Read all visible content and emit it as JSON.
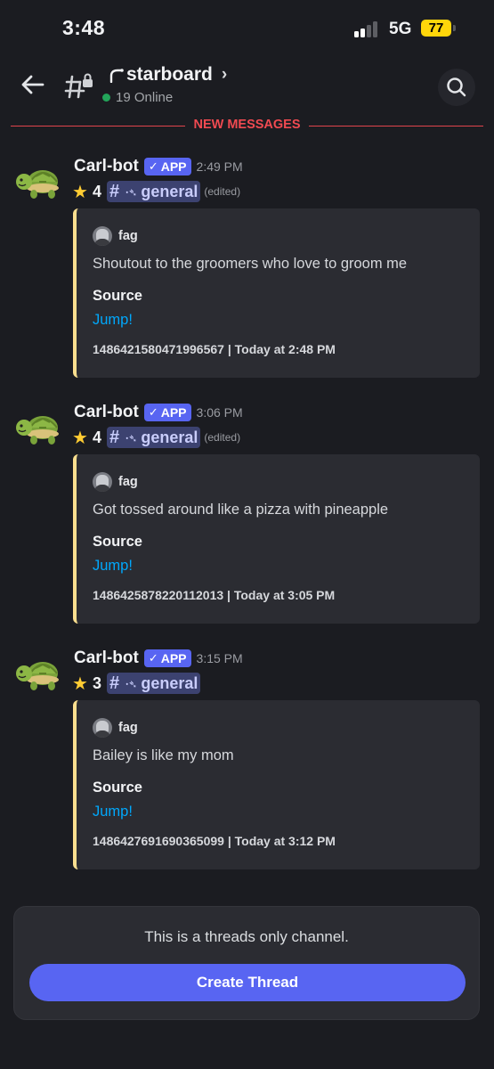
{
  "status_bar": {
    "time": "3:48",
    "network": "5G",
    "battery": "77"
  },
  "header": {
    "channel_name": "starboard",
    "online_text": "19 Online"
  },
  "divider": {
    "label": "NEW MESSAGES"
  },
  "messages": [
    {
      "author": "Carl-bot",
      "badge": "APP",
      "timestamp": "2:49 PM",
      "star_count": "4",
      "channel_mention": "general",
      "edited": "(edited)",
      "embed": {
        "author": "fag",
        "description": "Shoutout to the groomers who love to groom me",
        "field_name": "Source",
        "field_value": "Jump!",
        "footer": "1486421580471996567 | Today at 2:48 PM"
      }
    },
    {
      "author": "Carl-bot",
      "badge": "APP",
      "timestamp": "3:06 PM",
      "star_count": "4",
      "channel_mention": "general",
      "edited": "(edited)",
      "embed": {
        "author": "fag",
        "description": "Got tossed around like a pizza with pineapple",
        "field_name": "Source",
        "field_value": "Jump!",
        "footer": "1486425878220112013 | Today at 3:05 PM"
      }
    },
    {
      "author": "Carl-bot",
      "badge": "APP",
      "timestamp": "3:15 PM",
      "star_count": "3",
      "channel_mention": "general",
      "edited": "",
      "embed": {
        "author": "fag",
        "description": "Bailey is like my mom",
        "field_name": "Source",
        "field_value": "Jump!",
        "footer": "1486427691690365099 | Today at 3:12 PM"
      }
    }
  ],
  "threads_panel": {
    "notice": "This is a threads only channel.",
    "button_label": "Create Thread"
  },
  "colors": {
    "background": "#1b1c21",
    "accent": "#5865f2",
    "embed_border": "#fcdf8f",
    "new_messages": "#f04a51",
    "link": "#00a8fc",
    "online": "#23a55a"
  },
  "icons": [
    "back-arrow-icon",
    "locked-thread-channel-icon",
    "search-icon",
    "turtle-avatar-icon",
    "star-icon",
    "checkmark-icon"
  ]
}
